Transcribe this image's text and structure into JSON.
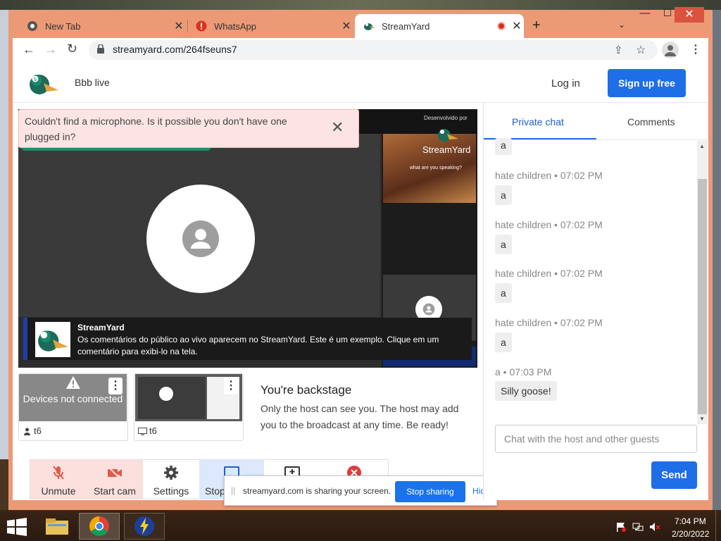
{
  "browser": {
    "tabs": [
      {
        "title": "New Tab",
        "icon": "chrome-icon"
      },
      {
        "title": "WhatsApp",
        "icon": "alert-icon"
      },
      {
        "title": "StreamYard",
        "icon": "streamyard-icon",
        "active": true,
        "recording": true
      }
    ],
    "url": "streamyard.com/264fseuns7"
  },
  "header": {
    "broadcast_name": "Bbb live",
    "login_label": "Log in",
    "signup_label": "Sign up free"
  },
  "alert": {
    "message": "Couldn't find a microphone. Is it possible you don't have one plugged in?"
  },
  "stage": {
    "powered_by": "Desenvolvido por",
    "side_brand": "StreamYard",
    "side_caption": "what are you speaking?",
    "banner_name": "StreamYard",
    "banner_text": "Os comentários do público ao vivo aparecem no StreamYard. Este é um exemplo. Clique em um comentário para exibi-lo na tela."
  },
  "cards": [
    {
      "status": "Devices not connected",
      "label": "t6",
      "icon": "person-icon"
    },
    {
      "label": "t6",
      "icon": "monitor-icon"
    }
  ],
  "backstage": {
    "title": "You're backstage",
    "text": "Only the host can see you. The host may add you to the broadcast at any time. Be ready!"
  },
  "controls": [
    {
      "label": "Unmute",
      "icon": "mic-off-icon"
    },
    {
      "label": "Start cam",
      "icon": "cam-off-icon"
    },
    {
      "label": "Settings",
      "icon": "gear-icon"
    },
    {
      "label": "Stop",
      "icon": "screen-icon"
    },
    {
      "label": "",
      "icon": "add-screen-icon"
    },
    {
      "label": "",
      "icon": "leave-icon"
    }
  ],
  "sharebar": {
    "text": "streamyard.com is sharing your screen.",
    "stop_label": "Stop sharing",
    "hide_label": "Hide"
  },
  "chat": {
    "tabs": [
      "Private chat",
      "Comments"
    ],
    "top_partial": "a",
    "messages": [
      {
        "author": "hate children",
        "time": "07:02 PM",
        "text": "a"
      },
      {
        "author": "hate children",
        "time": "07:02 PM",
        "text": "a"
      },
      {
        "author": "hate children",
        "time": "07:02 PM",
        "text": "a"
      },
      {
        "author": "hate children",
        "time": "07:02 PM",
        "text": "a"
      },
      {
        "author": "a",
        "time": "07:03 PM",
        "text": "Silly goose!"
      }
    ],
    "input_placeholder": "Chat with the host and other guests",
    "send_label": "Send"
  },
  "taskbar": {
    "time": "7:04 PM",
    "date": "2/20/2022"
  },
  "colors": {
    "window_frame": "#ec9a76",
    "brand_blue": "#1e6ee8",
    "alert_bg": "#fde4e4",
    "control_red": "#e05a4f"
  }
}
